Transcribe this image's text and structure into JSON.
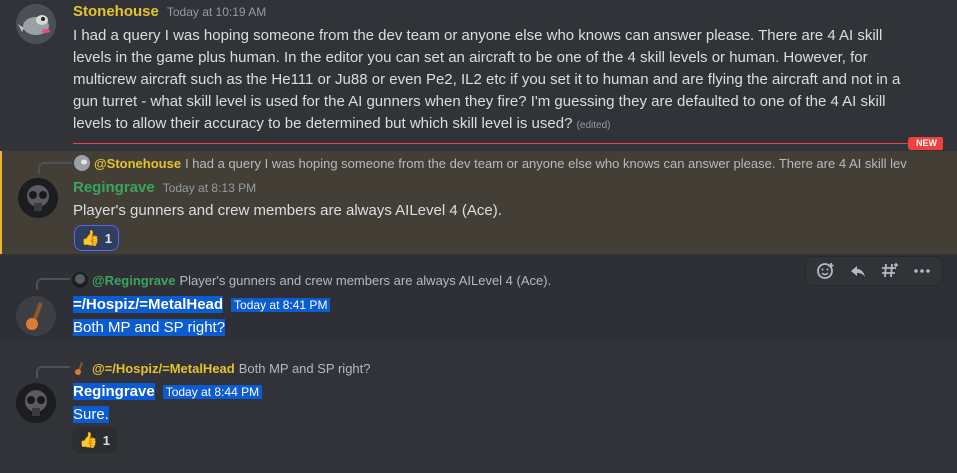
{
  "messages": [
    {
      "author": "Stonehouse",
      "timestamp": "Today at 10:19 AM",
      "text": "I had a query I was hoping someone from the dev team or anyone else who knows can answer please. There are 4 AI skill levels in the game plus human. In the editor you can set an aircraft to be one of the 4 skill levels or human. However, for multicrew aircraft such as the He111 or Ju88 or even Pe2, IL2 etc if you set it to human and are flying the aircraft and not in a gun turret - what skill level is used for the AI gunners when they fire? I'm guessing they are defaulted to one of the 4 AI skill levels to allow their accuracy to be determined but which skill level is used?",
      "edited": "(edited)",
      "colors": {
        "name": "#e6c32e"
      }
    },
    {
      "reply": {
        "name": "@Stonehouse",
        "text": "I had a query I was hoping someone from the dev team or anyone else who knows can answer please. There are 4 AI skill lev"
      },
      "author": "Regingrave",
      "timestamp": "Today at 8:13 PM",
      "text": "Player's gunners and crew members are always AILevel 4 (Ace).",
      "reaction": {
        "emoji": "👍",
        "count": "1"
      }
    },
    {
      "reply": {
        "name": "@Regingrave",
        "text": "Player's gunners and crew members are always AILevel 4 (Ace)."
      },
      "author": "=/Hospiz/=MetalHead",
      "timestamp": "Today at 8:41 PM",
      "text": "Both MP and SP right?"
    },
    {
      "reply": {
        "name": "@=/Hospiz/=MetalHead",
        "text": "Both MP and SP right?"
      },
      "author": "Regingrave",
      "timestamp": "Today at 8:44 PM",
      "text": "Sure.",
      "reaction": {
        "emoji": "👍",
        "count": "1"
      }
    }
  ],
  "divider": {
    "badge": "NEW"
  },
  "toolbar": {
    "icons": [
      "add-reaction-icon",
      "reply-icon",
      "create-thread-icon",
      "more-icon"
    ]
  },
  "colors": {
    "background": "#313338",
    "selection": "#0b5bd3",
    "mention_bg": "#433f37",
    "new_red": "#f23f42"
  }
}
